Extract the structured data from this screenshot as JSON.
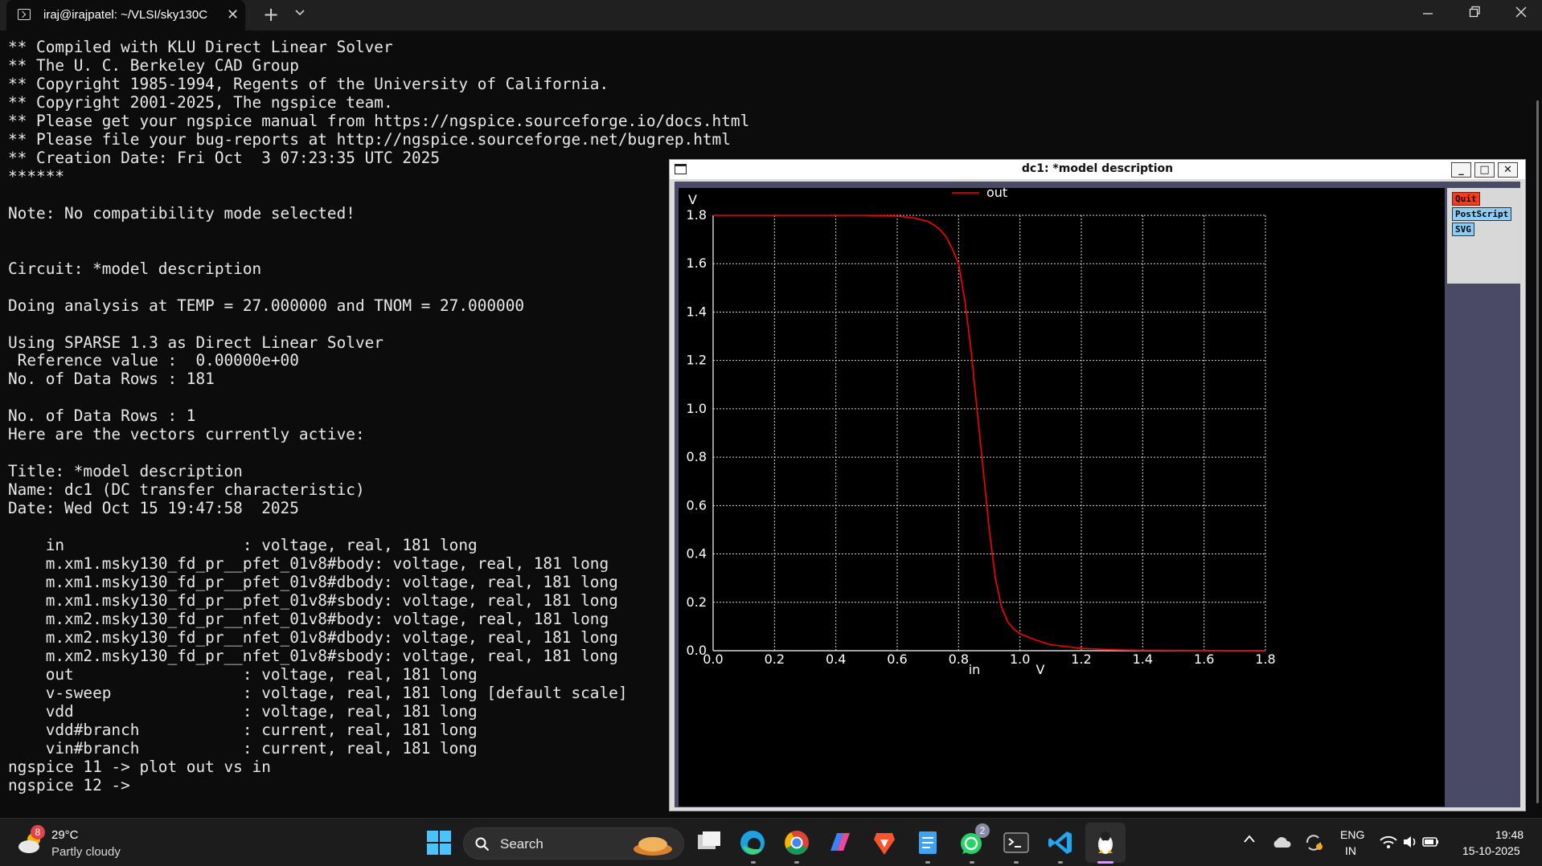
{
  "titlebar": {
    "tab_title": "iraj@irajpatel: ~/VLSI/sky130C",
    "new_tab_symbol": "+",
    "dropdown_symbol": "⌄",
    "close_symbol": "✕",
    "window_controls": {
      "minimize": "—",
      "restore": "❐",
      "close": "✕"
    }
  },
  "terminal": {
    "lines": [
      "** Compiled with KLU Direct Linear Solver",
      "** The U. C. Berkeley CAD Group",
      "** Copyright 1985-1994, Regents of the University of California.",
      "** Copyright 2001-2025, The ngspice team.",
      "** Please get your ngspice manual from https://ngspice.sourceforge.io/docs.html",
      "** Please file your bug-reports at http://ngspice.sourceforge.net/bugrep.html",
      "** Creation Date: Fri Oct  3 07:23:35 UTC 2025",
      "******",
      "",
      "Note: No compatibility mode selected!",
      "",
      "",
      "Circuit: *model description",
      "",
      "Doing analysis at TEMP = 27.000000 and TNOM = 27.000000",
      "",
      "Using SPARSE 1.3 as Direct Linear Solver",
      " Reference value :  0.00000e+00",
      "No. of Data Rows : 181",
      "",
      "No. of Data Rows : 1",
      "Here are the vectors currently active:",
      "",
      "Title: *model description",
      "Name: dc1 (DC transfer characteristic)",
      "Date: Wed Oct 15 19:47:58  2025",
      "",
      "    in                   : voltage, real, 181 long",
      "    m.xm1.msky130_fd_pr__pfet_01v8#body: voltage, real, 181 long",
      "    m.xm1.msky130_fd_pr__pfet_01v8#dbody: voltage, real, 181 long",
      "    m.xm1.msky130_fd_pr__pfet_01v8#sbody: voltage, real, 181 long",
      "    m.xm2.msky130_fd_pr__nfet_01v8#body: voltage, real, 181 long",
      "    m.xm2.msky130_fd_pr__nfet_01v8#dbody: voltage, real, 181 long",
      "    m.xm2.msky130_fd_pr__nfet_01v8#sbody: voltage, real, 181 long",
      "    out                  : voltage, real, 181 long",
      "    v-sweep              : voltage, real, 181 long [default scale]",
      "    vdd                  : voltage, real, 181 long",
      "    vdd#branch           : current, real, 181 long",
      "    vin#branch           : current, real, 181 long",
      "ngspice 11 -> plot out vs in",
      "ngspice 12 -> "
    ]
  },
  "plot_window": {
    "title": "dc1: *model description",
    "buttons": {
      "minimize": "_",
      "maximize": "□",
      "close": "✕"
    },
    "side_buttons": {
      "quit": "Quit",
      "postscript": "PostScript",
      "svg": "SVG"
    }
  },
  "chart_data": {
    "type": "line",
    "title": "",
    "xlabel": "in",
    "xunit": "V",
    "ylabel": "V",
    "xlim": [
      0.0,
      1.8
    ],
    "ylim": [
      0.0,
      1.8
    ],
    "x_ticks": [
      "0.0",
      "0.2",
      "0.4",
      "0.6",
      "0.8",
      "1.0",
      "1.2",
      "1.4",
      "1.6",
      "1.8"
    ],
    "y_ticks": [
      "0.0",
      "0.2",
      "0.4",
      "0.6",
      "0.8",
      "1.0",
      "1.2",
      "1.4",
      "1.6",
      "1.8"
    ],
    "grid": true,
    "legend_position": "top-center",
    "series": [
      {
        "name": "out",
        "color": "#ff0000",
        "x": [
          0.0,
          0.5,
          0.6,
          0.65,
          0.7,
          0.72,
          0.74,
          0.76,
          0.78,
          0.8,
          0.82,
          0.84,
          0.86,
          0.88,
          0.9,
          0.92,
          0.94,
          0.96,
          0.98,
          1.0,
          1.05,
          1.1,
          1.2,
          1.3,
          1.4,
          1.8
        ],
        "values": [
          1.8,
          1.8,
          1.797,
          1.79,
          1.775,
          1.76,
          1.74,
          1.71,
          1.66,
          1.6,
          1.45,
          1.25,
          1.0,
          0.75,
          0.5,
          0.3,
          0.18,
          0.12,
          0.09,
          0.07,
          0.045,
          0.025,
          0.01,
          0.004,
          0.002,
          0.0
        ]
      }
    ]
  },
  "taskbar": {
    "weather": {
      "temp": "29°C",
      "desc": "Partly cloudy",
      "badge": "8"
    },
    "search_label": "Search",
    "whatsapp_badge": "2",
    "lang": {
      "line1": "ENG",
      "line2": "IN"
    },
    "clock": {
      "time": "19:48",
      "date": "15-10-2025"
    },
    "chevron": "^"
  }
}
